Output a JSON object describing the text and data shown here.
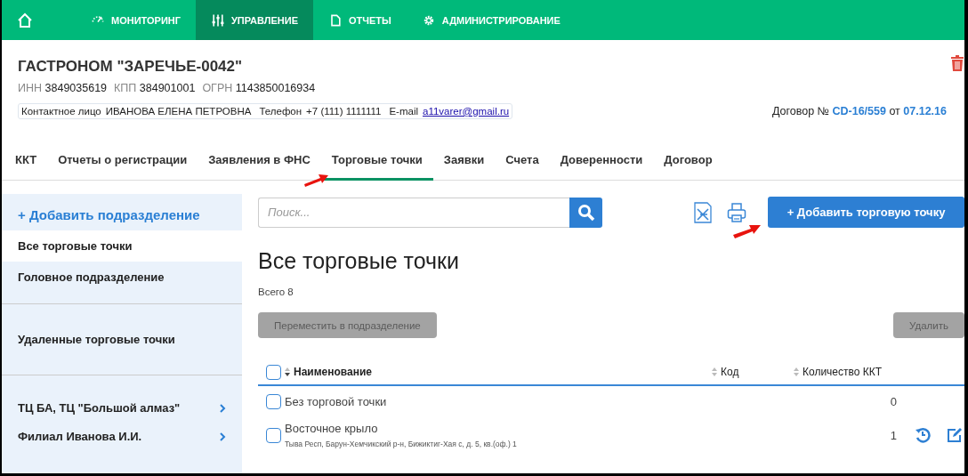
{
  "nav": [
    {
      "kind": "home",
      "selected": false
    },
    {
      "kind": "gauge",
      "label": "МОНИТОРИНГ",
      "selected": false
    },
    {
      "kind": "sliders",
      "label": "УПРАВЛЕНИЕ",
      "selected": true
    },
    {
      "kind": "document",
      "label": "ОТЧЕТЫ",
      "selected": false
    },
    {
      "kind": "gear",
      "label": "АДМИНИСТРИРОВАНИЕ",
      "selected": false
    }
  ],
  "company": {
    "name": "ГАСТРОНОМ \"ЗАРЕЧЬЕ-0042\"",
    "details": [
      {
        "label": "ИНН",
        "value": "3849035619"
      },
      {
        "label": "КПП",
        "value": "384901001"
      },
      {
        "label": "ОГРН",
        "value": "1143850016934"
      }
    ],
    "contacts": [
      {
        "label": "Контактное лицо",
        "value": "ИВАНОВА ЕЛЕНА ПЕТРОВНА",
        "kind": "text"
      },
      {
        "label": "Телефон",
        "value": "+7 (111) 1111111",
        "kind": "text"
      },
      {
        "label": "E-mail",
        "value": "a11varer@gmail.ru",
        "kind": "link"
      }
    ],
    "contract": {
      "label": "Договор №",
      "number": "CD-16/559",
      "joiner": "от",
      "date": "07.12.16"
    }
  },
  "tabs": [
    {
      "label": "ККТ",
      "selected": false
    },
    {
      "label": "Отчеты о регистрации",
      "selected": false
    },
    {
      "label": "Заявления в ФНС",
      "selected": false
    },
    {
      "label": "Торговые точки",
      "selected": true
    },
    {
      "label": "Заявки",
      "selected": false
    },
    {
      "label": "Счета",
      "selected": false
    },
    {
      "label": "Доверенности",
      "selected": false
    },
    {
      "label": "Договор",
      "selected": false
    }
  ],
  "sidebar": {
    "add_label": "+ Добавить подразделение",
    "sections": [
      [
        {
          "label": "Все торговые точки",
          "kind": "item",
          "selected": true
        },
        {
          "label": "Головное подразделение",
          "kind": "item",
          "selected": false
        }
      ],
      [
        {
          "label": "Удаленные торговые точки",
          "kind": "item",
          "selected": false
        }
      ],
      [
        {
          "label": "ТЦ БА, ТЦ \"Большой алмаз\"",
          "kind": "group",
          "selected": false
        },
        {
          "label": "Филиал Иванова И.И.",
          "kind": "group",
          "selected": false
        }
      ]
    ]
  },
  "toolbar": {
    "search": {
      "placeholder": "Поиск..."
    },
    "add_button": "+ Добавить торговую точку"
  },
  "page_title": "Все торговые точки",
  "total": "Всего 8",
  "actions": [
    {
      "label": "Переместить в подразделение",
      "disabled": true
    },
    {
      "label": "Удалить",
      "disabled": true
    }
  ],
  "table": {
    "select_all": {
      "checked": false
    },
    "columns": [
      {
        "label": "Наименование",
        "sorted": true
      },
      {
        "label": "Код",
        "sorted": false
      },
      {
        "label": "Количество ККТ",
        "sorted": false
      }
    ],
    "rows": [
      {
        "name": "Без торговой точки",
        "count": "0",
        "checked": false,
        "tools": false
      },
      {
        "name": "Восточное крыло",
        "address": "Тыва Респ, Барун-Хемчикский р-н, Бижиктиг-Хая с, д. 5, кв.(оф.) 1",
        "count": "1",
        "checked": false,
        "tools": true
      }
    ]
  }
}
